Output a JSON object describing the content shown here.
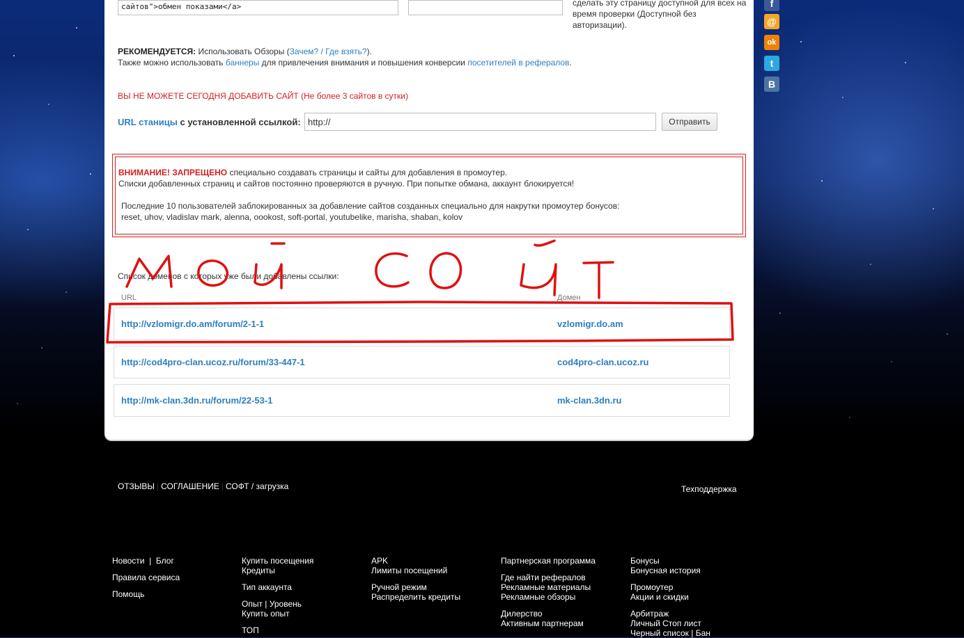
{
  "textarea_code": "сайтов\">обмен показами</a>",
  "side_note": [
    "сделать эту страницу доступной для всех на",
    "время проверки (Доступной без авторизации)."
  ],
  "recommend": {
    "label": "РЕКОМЕНДУЕТСЯ:",
    "text1": "Использовать Обзоры (",
    "link_why": "Зачем?",
    "slash": " / ",
    "link_where": "Где взять?",
    "text2": ").",
    "line2_a": "Также можно использовать ",
    "link_banners": "баннеры",
    "line2_b": " для привлечения внимания и повышения конверсии ",
    "link_visitors": "посетителей в рефералов",
    "line2_c": "."
  },
  "limit_warning": "ВЫ НЕ МОЖЕТЕ СЕГОДНЯ ДОБАВИТЬ САЙТ (Не более 3 сайтов в сутки)",
  "url_form": {
    "label_link": "URL станицы",
    "label_rest": " с установленной ссылкой:",
    "input_value": "http://",
    "submit": "Отправить"
  },
  "alert": {
    "title": "ВНИМАНИЕ! ЗАПРЕЩЕНО",
    "line1": " специально создавать страницы и сайты для добавления в промоутер.",
    "line2": "Списки добавленных страниц и сайтов постоянно проверяются в ручную. При попытке обмана, аккаунт блокируется!",
    "ban_title": "Последние 10 пользователей заблокированных за добавление сайтов созданных специально для накрутки промоутер бонусов:",
    "ban_list": "reset, uhov, vladislav mark, alenna, oookost, soft-portal, youtubelike, marisha, shaban, kolov"
  },
  "domains": {
    "title": "Список доменов с которых уже были добавлены ссылки:",
    "col_url": "URL",
    "col_domain": "Домен",
    "rows": [
      {
        "url": "http://vzlomigr.do.am/forum/2-1-1",
        "domain": "vzlomigr.do.am"
      },
      {
        "url": "http://cod4pro-clan.ucoz.ru/forum/33-447-1",
        "domain": "cod4pro-clan.ucoz.ru"
      },
      {
        "url": "http://mk-clan.3dn.ru/forum/22-53-1",
        "domain": "mk-clan.3dn.ru"
      }
    ]
  },
  "social": [
    {
      "icon": "facebook-icon",
      "glyph": "f",
      "color": "#3b5998"
    },
    {
      "icon": "mail-icon",
      "glyph": "@",
      "color": "#f5a623"
    },
    {
      "icon": "odnoklassniki-icon",
      "glyph": "ok",
      "color": "#ee8208"
    },
    {
      "icon": "twitter-icon",
      "glyph": "t",
      "color": "#2aa9e0"
    },
    {
      "icon": "vkontakte-icon",
      "glyph": "B",
      "color": "#4c75a3"
    }
  ],
  "footer": {
    "links": [
      "ОТЗЫВЫ",
      "СОГЛАШЕНИЕ",
      "СОФТ / загрузка"
    ],
    "support": "Техподдержка",
    "col1": [
      "Новости",
      "|",
      "Блог",
      "Правила сервиса",
      "Помощь"
    ],
    "col2": [
      "Купить посещения",
      "Кредиты",
      "Тип аккаунта",
      "Опыт",
      "|",
      "Уровень",
      "Купить опыт",
      "ТОП"
    ],
    "col3": [
      "APK",
      "Лимиты посещений",
      "Ручной режим",
      "Распределить кредиты"
    ],
    "col4": [
      "Партнерская программа",
      "Где найти рефералов",
      "Рекламные материалы",
      "Рекламные обзоры",
      "Дилерство",
      "Активным партнерам"
    ],
    "col5": [
      "Бонусы",
      "Бонусная история",
      "Промоутер",
      "Акции и скидки",
      "Арбитраж",
      "Личный Стоп лист",
      "Черный список",
      "|",
      "Бан"
    ]
  },
  "colors": {
    "link": "#2f7fbf",
    "warning": "#d42020",
    "scribble": "#e01010"
  }
}
